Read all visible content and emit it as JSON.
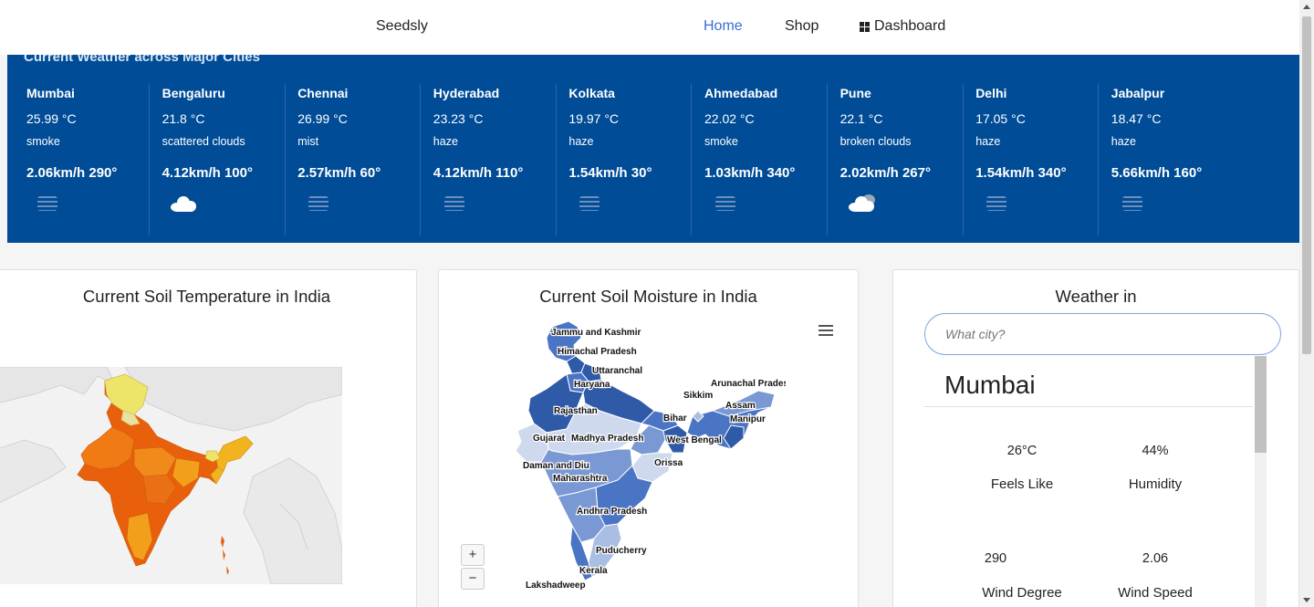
{
  "nav": {
    "brand": "Seedsly",
    "home": "Home",
    "shop": "Shop",
    "dashboard": "Dashboard",
    "active_color": "#3b6fd4"
  },
  "weather_strip": {
    "title": "Current Weather across Major Cities",
    "background": "#004c97",
    "cities": [
      {
        "name": "Mumbai",
        "temp": "25.99 °C",
        "desc": "smoke",
        "wind": "2.06km/h 290°",
        "icon": "haze-icon"
      },
      {
        "name": "Bengaluru",
        "temp": "21.8 °C",
        "desc": "scattered clouds",
        "wind": "4.12km/h 100°",
        "icon": "cloud-icon"
      },
      {
        "name": "Chennai",
        "temp": "26.99 °C",
        "desc": "mist",
        "wind": "2.57km/h 60°",
        "icon": "haze-icon"
      },
      {
        "name": "Hyderabad",
        "temp": "23.23 °C",
        "desc": "haze",
        "wind": "4.12km/h 110°",
        "icon": "haze-icon"
      },
      {
        "name": "Kolkata",
        "temp": "19.97 °C",
        "desc": "haze",
        "wind": "1.54km/h 30°",
        "icon": "haze-icon"
      },
      {
        "name": "Ahmedabad",
        "temp": "22.02 °C",
        "desc": "smoke",
        "wind": "1.03km/h 340°",
        "icon": "haze-icon"
      },
      {
        "name": "Pune",
        "temp": "22.1 °C",
        "desc": "broken clouds",
        "wind": "2.02km/h 267°",
        "icon": "broken-cloud-icon"
      },
      {
        "name": "Delhi",
        "temp": "17.05 °C",
        "desc": "haze",
        "wind": "1.54km/h 340°",
        "icon": "haze-icon"
      },
      {
        "name": "Jabalpur",
        "temp": "18.47 °C",
        "desc": "haze",
        "wind": "5.66km/h 160°",
        "icon": "haze-icon"
      }
    ]
  },
  "soil_temp": {
    "title": "Current Soil Temperature in India",
    "colors": [
      "#e8600c",
      "#f08a1a",
      "#f2b41e",
      "#ede46a",
      "#e8e8e8"
    ]
  },
  "soil_moisture": {
    "title": "Current Soil Moisture in India",
    "zoom_in": "+",
    "zoom_out": "−",
    "region_labels": [
      "Jammu and Kashmir",
      "Himachal Pradesh",
      "Uttaranchal",
      "Haryana",
      "Arunachal Pradesh",
      "Sikkim",
      "Assam",
      "Rajasthan",
      "Bihar",
      "Manipur",
      "Gujarat",
      "Madhya Pradesh",
      "West Bengal",
      "Orissa",
      "Daman and Diu",
      "Maharashtra",
      "Andhra Pradesh",
      "Puducherry",
      "Kerala",
      "Lakshadweep"
    ],
    "colors": [
      "#2f5aa8",
      "#4a74c4",
      "#7a98d3",
      "#aabde2",
      "#cfd9ee"
    ]
  },
  "weather_in": {
    "title": "Weather in",
    "placeholder": "What city?",
    "city": "Mumbai",
    "temp": "26°C",
    "humidity": "44%",
    "feels_like_label": "Feels Like",
    "humidity_label": "Humidity",
    "wind_degree": "290",
    "wind_speed": "2.06",
    "wind_degree_label": "Wind Degree",
    "wind_speed_label": "Wind Speed"
  }
}
